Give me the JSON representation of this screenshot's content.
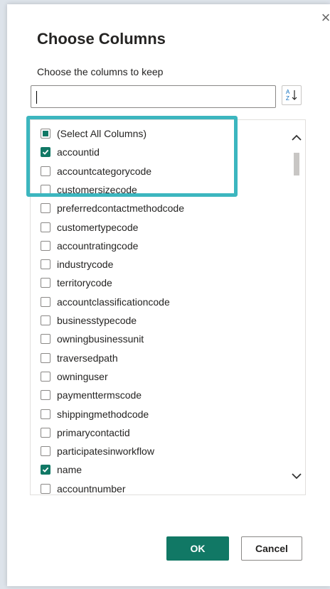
{
  "dialog": {
    "title": "Choose Columns",
    "subtitle": "Choose the columns to keep",
    "search": {
      "value": "",
      "placeholder": ""
    },
    "close_glyph": "×",
    "sort_icon": "sort-az-icon"
  },
  "columns": [
    {
      "label": "(Select All Columns)",
      "state": "partial"
    },
    {
      "label": "accountid",
      "state": "checked"
    },
    {
      "label": "accountcategorycode",
      "state": "unchecked"
    },
    {
      "label": "customersizecode",
      "state": "unchecked"
    },
    {
      "label": "preferredcontactmethodcode",
      "state": "unchecked"
    },
    {
      "label": "customertypecode",
      "state": "unchecked"
    },
    {
      "label": "accountratingcode",
      "state": "unchecked"
    },
    {
      "label": "industrycode",
      "state": "unchecked"
    },
    {
      "label": "territorycode",
      "state": "unchecked"
    },
    {
      "label": "accountclassificationcode",
      "state": "unchecked"
    },
    {
      "label": "businesstypecode",
      "state": "unchecked"
    },
    {
      "label": "owningbusinessunit",
      "state": "unchecked"
    },
    {
      "label": "traversedpath",
      "state": "unchecked"
    },
    {
      "label": "owninguser",
      "state": "unchecked"
    },
    {
      "label": "paymenttermscode",
      "state": "unchecked"
    },
    {
      "label": "shippingmethodcode",
      "state": "unchecked"
    },
    {
      "label": "primarycontactid",
      "state": "unchecked"
    },
    {
      "label": "participatesinworkflow",
      "state": "unchecked"
    },
    {
      "label": "name",
      "state": "checked"
    },
    {
      "label": "accountnumber",
      "state": "unchecked"
    }
  ],
  "buttons": {
    "ok": "OK",
    "cancel": "Cancel"
  },
  "colors": {
    "accent": "#117865",
    "highlight": "#3cb6bf"
  }
}
